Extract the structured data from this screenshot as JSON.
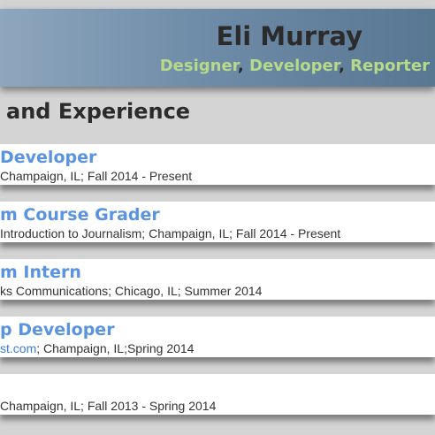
{
  "header": {
    "name": "Eli Murray",
    "roles": [
      "Designer",
      "Developer",
      "Reporter"
    ],
    "separator": ","
  },
  "section": {
    "title": "and Experience"
  },
  "experience": [
    {
      "title": "Developer",
      "detail": "Champaign, IL; Fall 2014 - Present"
    },
    {
      "title": "m Course Grader",
      "detail": "Introduction to Journalism; Champaign, IL; Fall 2014 - Present"
    },
    {
      "title": "m Intern",
      "detail": "ks Communications; Chicago, IL; Summer 2014"
    },
    {
      "title": "p Developer",
      "detail_link": "st.com",
      "detail_rest": "; Champaign, IL;Spring 2014"
    },
    {
      "title": "",
      "detail": "Champaign, IL; Fall 2013 - Spring 2014"
    }
  ],
  "colors": {
    "accent_title": "#5a93e0",
    "role_green": "#b6d98a",
    "header_gradient": [
      "#8ea6bd",
      "#587792"
    ]
  }
}
